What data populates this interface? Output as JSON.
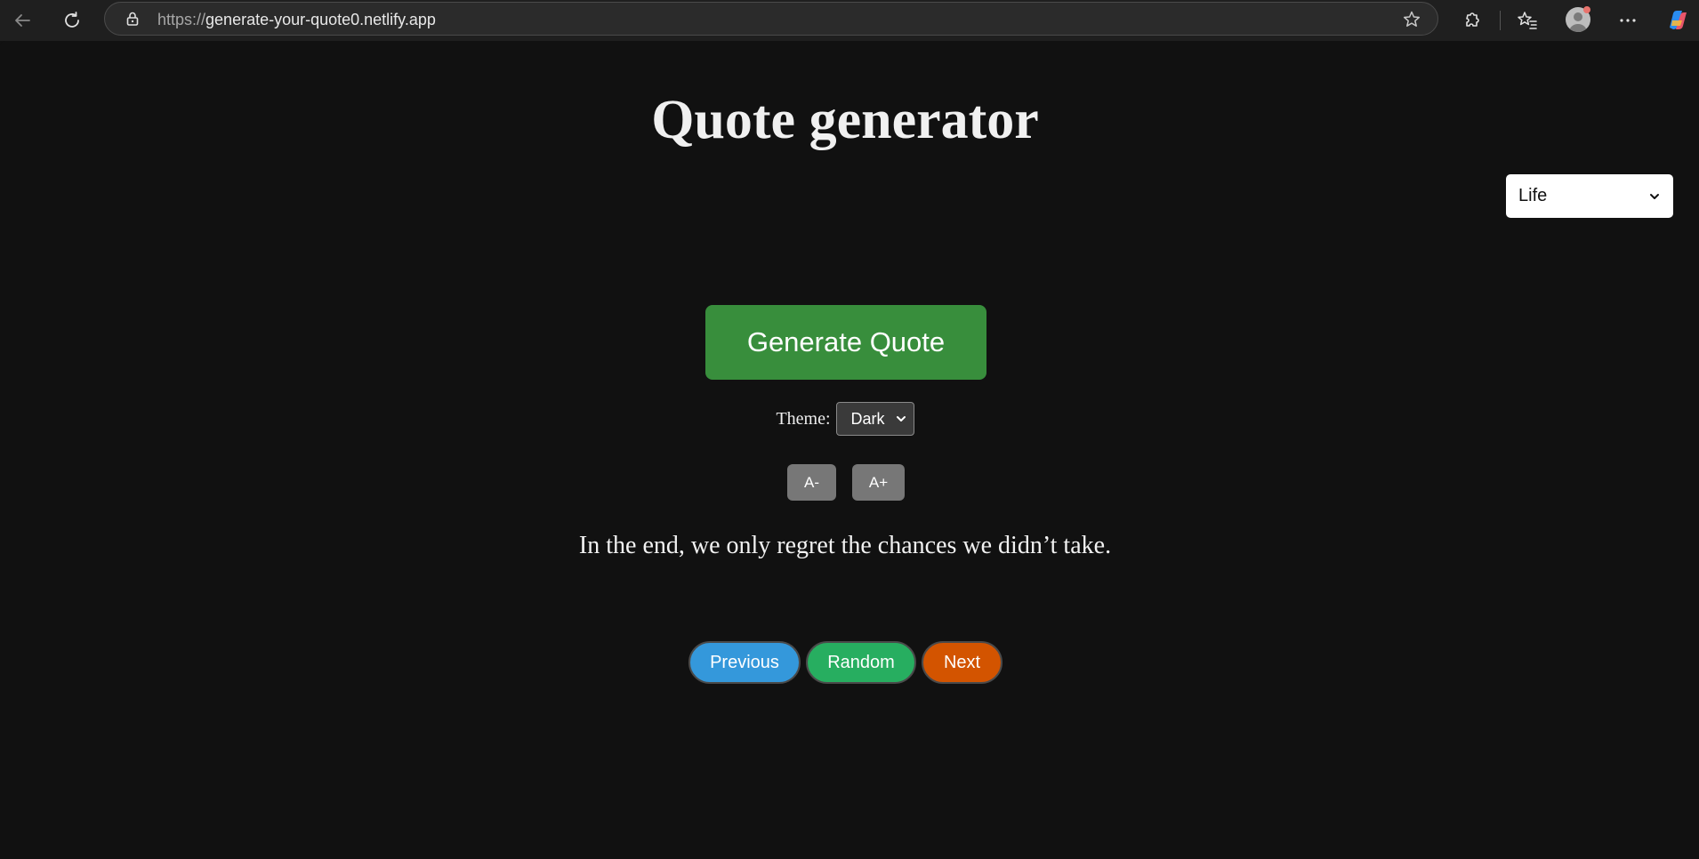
{
  "browser": {
    "url_scheme": "https://",
    "url_host": "generate-your-quote0.netlify.app",
    "icons": [
      "back-arrow-icon",
      "reload-icon",
      "lock-icon",
      "star-icon",
      "extensions-icon",
      "favorites-icon",
      "profile-avatar",
      "more-icon",
      "copilot-icon"
    ]
  },
  "page": {
    "title": "Quote generator",
    "category_select": {
      "selected": "Life"
    },
    "generate_button": "Generate Quote",
    "theme": {
      "label": "Theme:",
      "selected": "Dark"
    },
    "font_controls": {
      "decrease": "A-",
      "increase": "A+"
    },
    "quote": "In the end, we only regret the chances we didn’t take.",
    "nav": {
      "previous": "Previous",
      "random": "Random",
      "next": "Next"
    }
  },
  "colors": {
    "page_background": "#111111",
    "generate_button": "#388e3c",
    "previous_button": "#3498db",
    "random_button": "#27ae60",
    "next_button": "#d35400",
    "font_button": "#777777"
  }
}
